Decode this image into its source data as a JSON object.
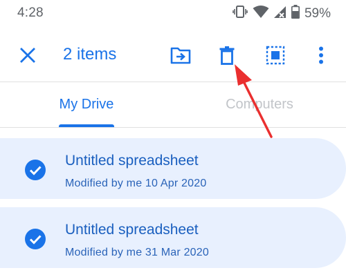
{
  "status_bar": {
    "time": "4:28",
    "battery_percent": "59%",
    "icons": [
      "vibrate-icon",
      "wifi-icon",
      "signal-no-data-icon",
      "battery-icon"
    ]
  },
  "toolbar": {
    "selection_count": "2 items",
    "actions": [
      "close-icon",
      "move-to-folder-icon",
      "trash-icon",
      "select-all-icon",
      "more-vert-icon"
    ]
  },
  "tabs": [
    {
      "label": "My Drive",
      "active": true
    },
    {
      "label": "Computers",
      "active": false
    }
  ],
  "files": [
    {
      "name": "Untitled spreadsheet",
      "meta": "Modified by me 10 Apr 2020",
      "selected": true
    },
    {
      "name": "Untitled spreadsheet",
      "meta": "Modified by me 31 Mar 2020",
      "selected": true
    }
  ],
  "colors": {
    "accent": "#1a73e8",
    "selected_row": "#e8f0fe",
    "inactive_tab": "#c2c5c9",
    "annotation": "#ea2f2f"
  }
}
